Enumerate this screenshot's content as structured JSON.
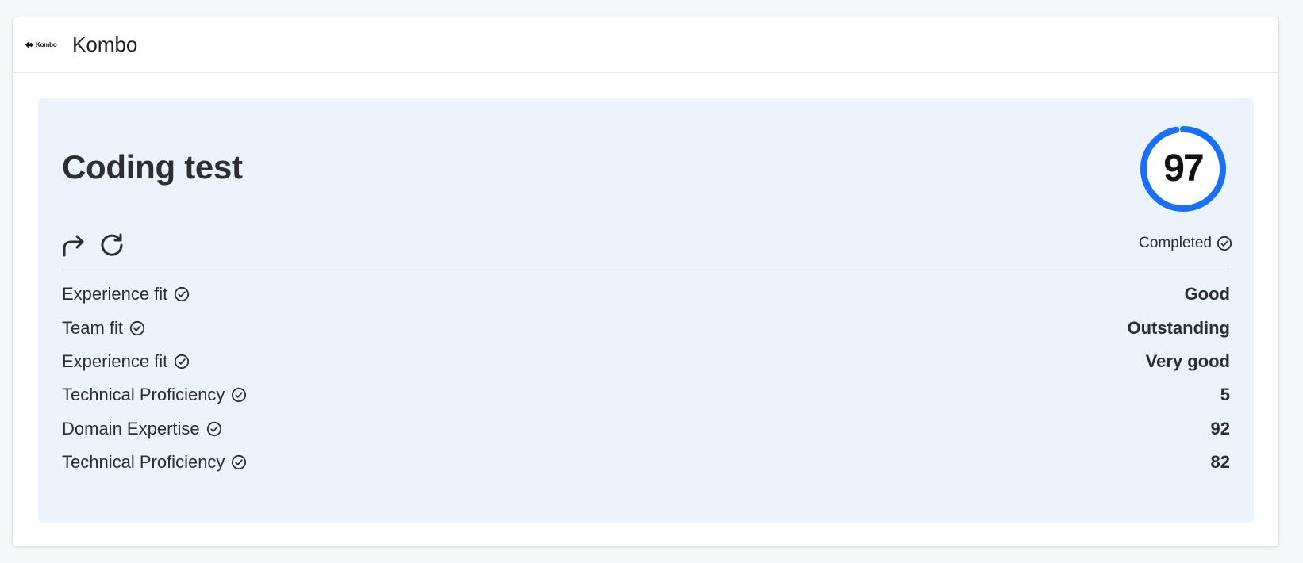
{
  "brand": {
    "logo_text": "Kombo",
    "title": "Kombo"
  },
  "test": {
    "title": "Coding test",
    "score": "97",
    "score_fraction": 0.97,
    "status": "Completed",
    "ring_color": "#1a6ff5"
  },
  "actions": {
    "forward_icon": "arrow-forward-icon",
    "retry_icon": "refresh-icon"
  },
  "metrics": [
    {
      "label": "Experience fit",
      "value": "Good"
    },
    {
      "label": "Team fit",
      "value": "Outstanding"
    },
    {
      "label": "Experience fit",
      "value": "Very good"
    },
    {
      "label": "Technical Proficiency",
      "value": "5"
    },
    {
      "label": "Domain Expertise",
      "value": "92"
    },
    {
      "label": "Technical Proficiency",
      "value": "82"
    }
  ]
}
